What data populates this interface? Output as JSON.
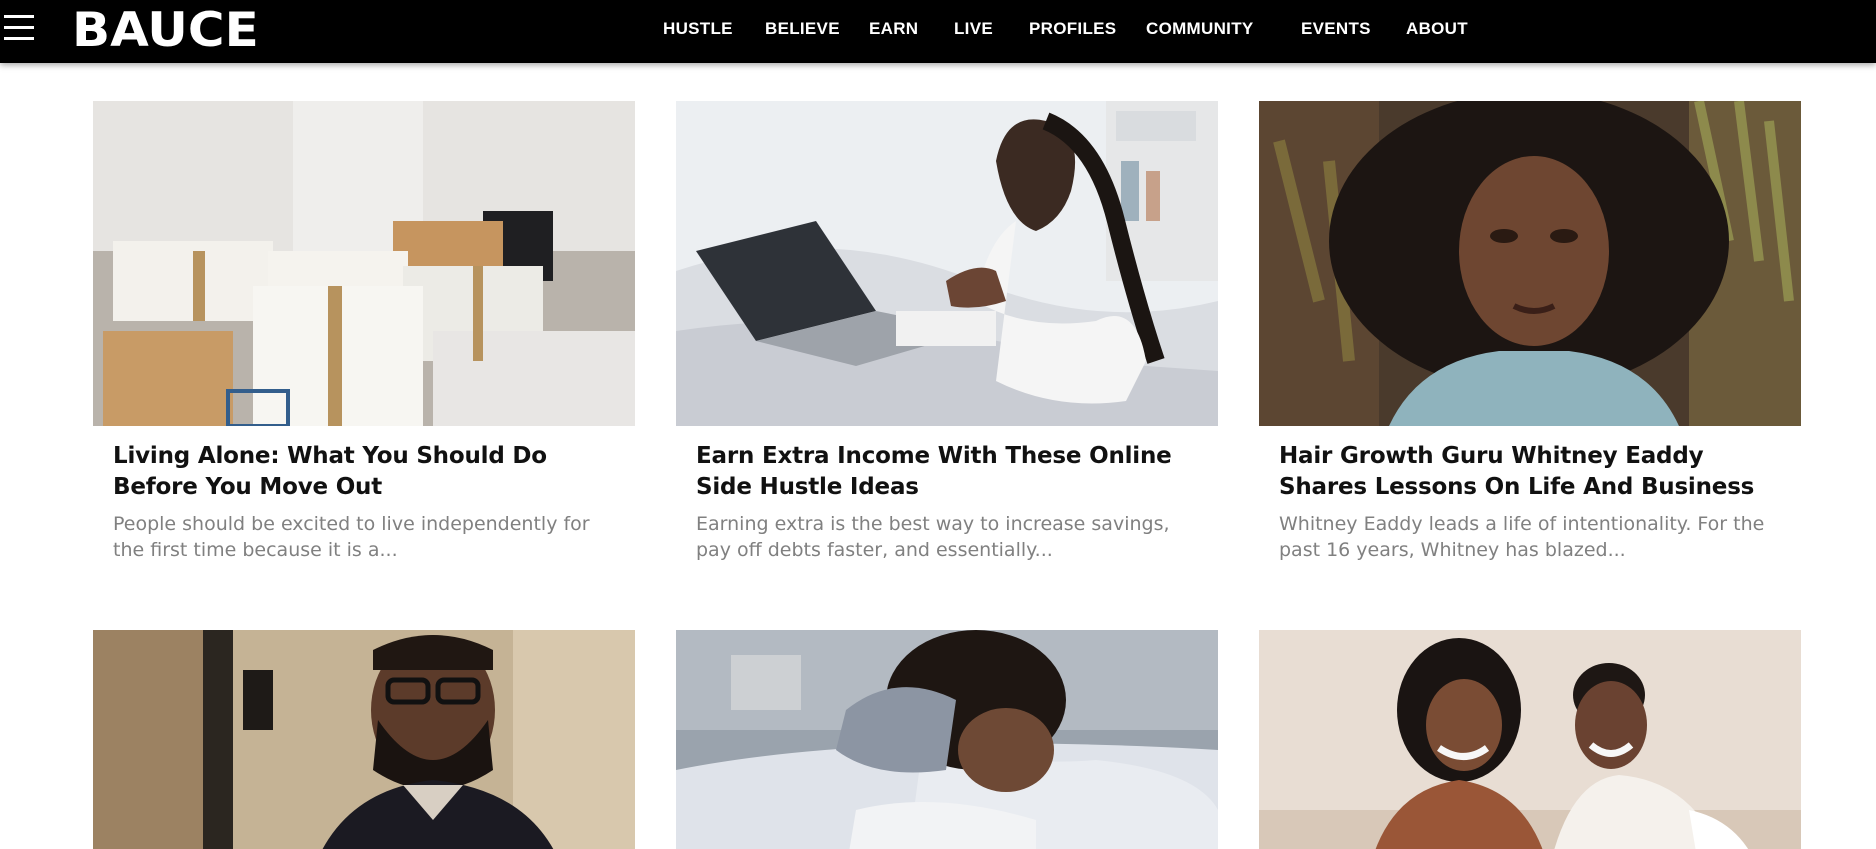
{
  "header": {
    "logo": "BAUCE",
    "nav": [
      "HUSTLE",
      "BELIEVE",
      "EARN",
      "LIVE",
      "PROFILES",
      "COMMUNITY",
      "EVENTS",
      "ABOUT"
    ]
  },
  "articles": [
    {
      "title": "Living Alone: What You Should Do Before You Move Out",
      "excerpt": "People should be excited to live independently for the first time because it is a...",
      "image": "moving-boxes-photo"
    },
    {
      "title": "Earn Extra Income With These Online Side Hustle Ideas",
      "excerpt": "Earning extra is the best way to increase savings, pay off debts faster, and essentially...",
      "image": "woman-laptop-bed-photo"
    },
    {
      "title": "Hair Growth Guru Whitney Eaddy Shares Lessons On Life And Business",
      "excerpt": "Whitney Eaddy leads a life of intentionality. For the past 16 years, Whitney has blazed...",
      "image": "woman-natural-hair-photo"
    },
    {
      "image": "man-glasses-portrait-photo"
    },
    {
      "image": "woman-sleeping-photo"
    },
    {
      "image": "two-women-smiling-photo"
    }
  ]
}
